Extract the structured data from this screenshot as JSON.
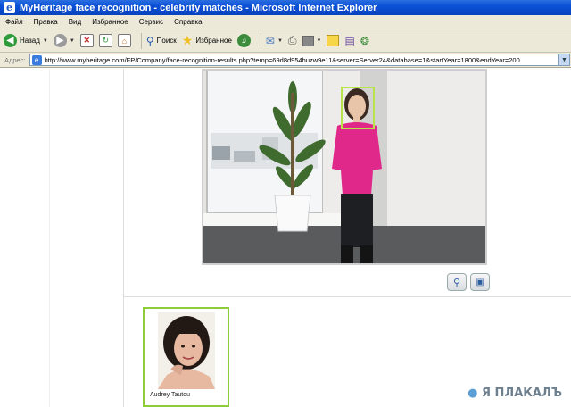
{
  "window": {
    "title": "MyHeritage face recognition - celebrity matches - Microsoft Internet Explorer"
  },
  "menu": [
    "Файл",
    "Правка",
    "Вид",
    "Избранное",
    "Сервис",
    "Справка"
  ],
  "toolbar": {
    "back_label": "Назад",
    "search_label": "Поиск",
    "favorites_label": "Избранное"
  },
  "address": {
    "label": "Адрес:",
    "url": "http://www.myheritage.com/FP/Company/face-recognition-results.php?temp=69d8d954huzw9e11&server=Server24&database=1&startYear=1800&endYear=200"
  },
  "match": {
    "name": "Audrey Tautou"
  },
  "watermark": {
    "text": "Я ПЛАКАЛЪ"
  },
  "colors": {
    "titlebar": "#0a50d6",
    "face_box": "#b8e34a",
    "card_border": "#8dcd3a"
  }
}
